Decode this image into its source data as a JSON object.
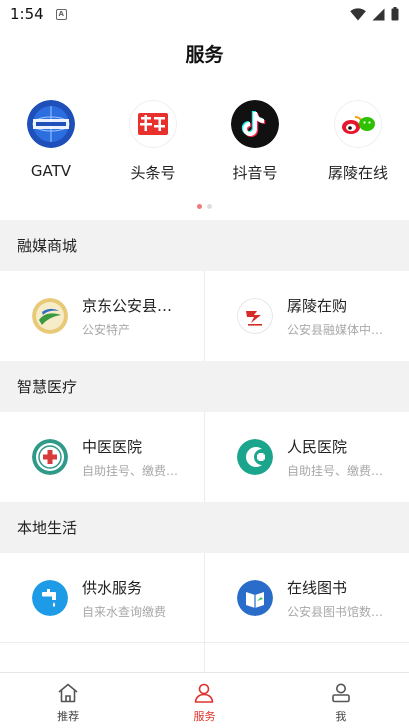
{
  "status_bar": {
    "time": "1:54",
    "notification_badge": "A"
  },
  "header": {
    "title": "服务"
  },
  "featured_apps": [
    {
      "label": "GATV",
      "icon": "gatv-logo-icon"
    },
    {
      "label": "头条号",
      "icon": "toutiao-logo-icon"
    },
    {
      "label": "抖音号",
      "icon": "tiktok-logo-icon"
    },
    {
      "label": "孱陵在线",
      "icon": "weibo-wechat-icon"
    }
  ],
  "pager": {
    "count": 2,
    "active_index": 0
  },
  "sections": [
    {
      "title": "融媒商城",
      "items": [
        {
          "title": "京东公安县…",
          "subtitle": "公安特产",
          "icon": "jd-gongan-logo-icon"
        },
        {
          "title": "孱陵在购",
          "subtitle": "公安县融媒体中…",
          "icon": "chanling-shop-logo-icon"
        }
      ]
    },
    {
      "title": "智慧医疗",
      "items": [
        {
          "title": "中医医院",
          "subtitle": "自助挂号、缴费…",
          "icon": "tcm-hospital-logo-icon"
        },
        {
          "title": "人民医院",
          "subtitle": "自助挂号、缴费…",
          "icon": "peoples-hospital-logo-icon"
        }
      ]
    },
    {
      "title": "本地生活",
      "items": [
        {
          "title": "供水服务",
          "subtitle": "自来水查询缴费",
          "icon": "water-tap-icon"
        },
        {
          "title": "在线图书",
          "subtitle": "公安县图书馆数…",
          "icon": "library-book-icon"
        }
      ]
    }
  ],
  "bottom_nav": [
    {
      "label": "推荐",
      "icon": "home-icon",
      "active": false
    },
    {
      "label": "服务",
      "icon": "person-icon",
      "active": true
    },
    {
      "label": "我",
      "icon": "profile-icon",
      "active": false
    }
  ],
  "colors": {
    "accent": "#e0322c",
    "section_bg": "#f2f2f2",
    "subtitle": "#a8a8a8"
  }
}
